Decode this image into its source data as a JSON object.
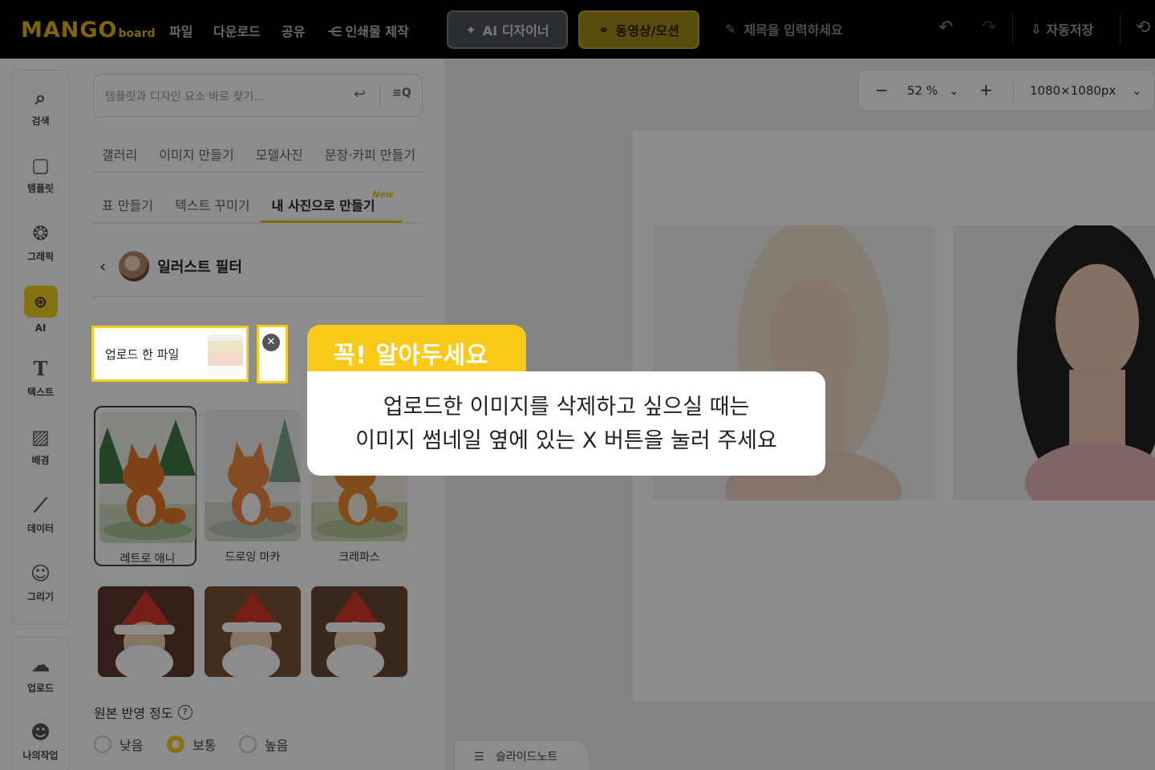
{
  "topbar": {
    "logo_main": "MANGO",
    "logo_sub": "board",
    "menu": [
      "파일",
      "다운로드",
      "공유",
      "인쇄물 제작"
    ],
    "ai_designer": "AI 디자이너",
    "video_motion": "동영상/모션",
    "title_placeholder": "제목을 입력하세요",
    "autosave": "자동저장"
  },
  "rail": {
    "items": [
      {
        "label": "검색",
        "icon": "search-icon"
      },
      {
        "label": "템플릿",
        "icon": "template-icon"
      },
      {
        "label": "그래픽",
        "icon": "graphic-icon"
      },
      {
        "label": "AI",
        "icon": "ai-chip-icon"
      },
      {
        "label": "텍스트",
        "icon": "text-icon"
      },
      {
        "label": "배경",
        "icon": "background-icon"
      },
      {
        "label": "데이터",
        "icon": "chart-icon"
      },
      {
        "label": "그리기",
        "icon": "draw-icon"
      }
    ],
    "bottom": [
      {
        "label": "업로드",
        "icon": "upload-icon"
      },
      {
        "label": "나의작업",
        "icon": "my-work-icon"
      }
    ]
  },
  "panel": {
    "search_placeholder": "템플릿과 디자인 요소 바로 찾기...",
    "tabs_row1": [
      "갤러리",
      "이미지 만들기",
      "모델사진",
      "문장·카피 만들기"
    ],
    "tabs_row2": [
      "표 만들기",
      "텍스트 꾸미기",
      "내 사진으로 만들기"
    ],
    "new_badge": "New",
    "filter_title": "일러스트 필터",
    "uploaded_file": "업로드 한 파일",
    "styles": [
      "레트로 애니",
      "드로잉 마카",
      "크레파스"
    ],
    "range_title": "원본 반영 정도",
    "range_options": [
      "낮음",
      "보통",
      "높음"
    ],
    "range_selected": "보통"
  },
  "canvas": {
    "zoom": "52 %",
    "size": "1080×1080px",
    "slide_note": "슬라이드노트"
  },
  "tooltip": {
    "tab": "꼭! 알아두세요",
    "line1": "업로드한 이미지를 삭제하고 싶으실 때는",
    "line2": "이미지 썸네일 옆에 있는 X 버튼을 눌러 주세요"
  },
  "colors": {
    "accent": "#f5cf1f",
    "topbar": "#000000"
  }
}
